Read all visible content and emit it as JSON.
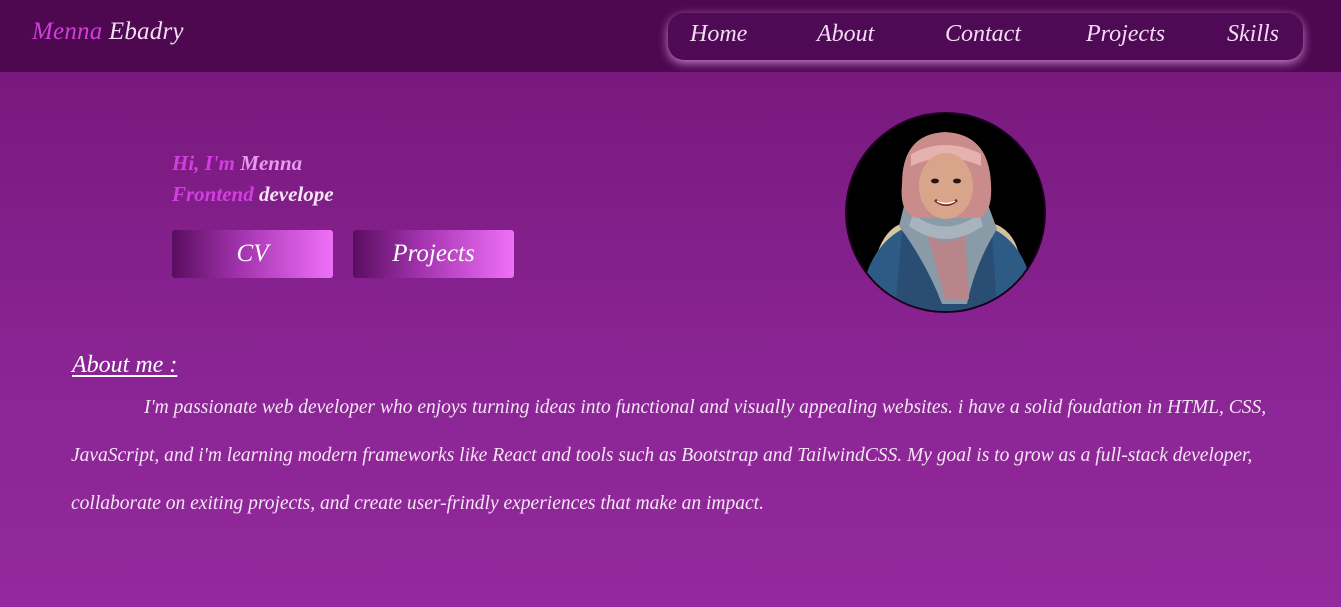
{
  "header": {
    "brand_first": "Menna",
    "brand_last": "Ebadry",
    "nav": [
      "Home",
      "About",
      "Contact",
      "Projects",
      "Skills"
    ]
  },
  "hero": {
    "greeting_hi": "Hi, I'm",
    "greeting_name": "Menna",
    "role_first": "Frontend",
    "role_rest": "developer",
    "cv_button": "CV",
    "projects_button": "Projects"
  },
  "about": {
    "heading": "About me :",
    "text": "I'm passionate web developer who enjoys turning ideas into functional and visually appealing websites. i have a solid foudation in HTML, CSS, JavaScript, and i'm learning modern frameworks like React and tools such as Bootstrap and TailwindCSS. My goal is to grow as a full-stack developer, collaborate on exiting projects, and create user-frindly experiences that make an impact."
  },
  "colors": {
    "header_bg": "#4d0850",
    "page_bg": "#7e1a83",
    "accent": "#d23fe0",
    "button_gradient_end": "#ef70f7"
  },
  "icons": {
    "avatar": "profile-photo"
  }
}
